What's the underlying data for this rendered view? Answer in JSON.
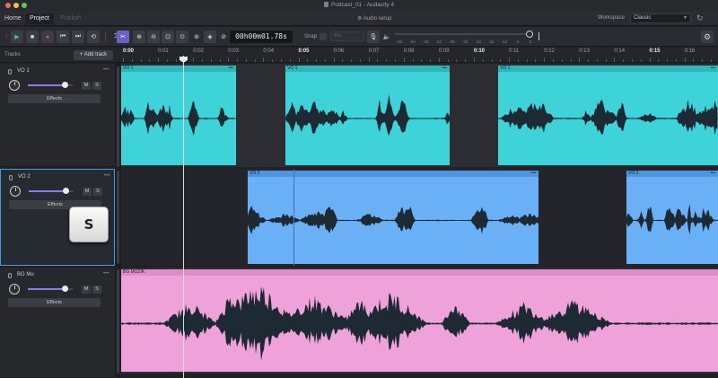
{
  "window": {
    "title": "Podcast_01 - Audacity 4"
  },
  "menubar": {
    "tabs": [
      {
        "label": "Home",
        "state": "normal"
      },
      {
        "label": "Project",
        "state": "active"
      },
      {
        "label": "Publish",
        "state": "disabled"
      }
    ],
    "center_items": [
      {
        "label": "Audio setup",
        "icon": "audio-setup-icon"
      }
    ],
    "workspace_label": "Workspace",
    "workspace_value": "Classic"
  },
  "toolbar": {
    "timecode": "00h00m01.78s",
    "snap_label": "Snap",
    "snap_select": "Bar",
    "meter_ticks": [
      "-60",
      "-54",
      "-48",
      "-42",
      "-36",
      "-30",
      "-24",
      "-18",
      "-12",
      "-6",
      "0"
    ]
  },
  "tracks_header": {
    "label": "Tracks",
    "add_track": "+ Add track"
  },
  "ruler": {
    "labels": [
      {
        "t": "0:00",
        "major": true
      },
      {
        "t": "0:01"
      },
      {
        "t": "0:02"
      },
      {
        "t": "0:03"
      },
      {
        "t": "0:04"
      },
      {
        "t": "0:05",
        "major": true
      },
      {
        "t": "0:06"
      },
      {
        "t": "0:07"
      },
      {
        "t": "0:08"
      },
      {
        "t": "0:09"
      },
      {
        "t": "0:10",
        "major": true
      },
      {
        "t": "0:11"
      },
      {
        "t": "0:12"
      },
      {
        "t": "0:13"
      },
      {
        "t": "0:14"
      },
      {
        "t": "0:15",
        "major": true
      },
      {
        "t": "0:16"
      }
    ]
  },
  "tracks": [
    {
      "name": "VO 1",
      "mute": "M",
      "solo": "S",
      "effects": "Effects",
      "volume": 0.82,
      "selected": false,
      "clips": [
        {
          "label": "VO 1",
          "color": "#3dd3d9",
          "header": "#2fb5bb"
        },
        {
          "label": "VO 1",
          "color": "#3dd3d9",
          "header": "#2fb5bb"
        },
        {
          "label": "VO 1",
          "color": "#3dd3d9",
          "header": "#2fb5bb"
        }
      ]
    },
    {
      "name": "VO 2",
      "mute": "M",
      "solo": "S",
      "effects": "Effects",
      "volume": 0.82,
      "selected": true,
      "clips": [
        {
          "label": "VO 2",
          "color": "#6ab0f7",
          "header": "#4d95de"
        },
        {
          "label": "VO 2",
          "color": "#6ab0f7",
          "header": "#4d95de"
        }
      ]
    },
    {
      "name": "BG Mu",
      "mute": "M",
      "solo": "S",
      "effects": "Effects",
      "volume": 0.82,
      "selected": false,
      "clips": [
        {
          "label": "BG MUZIK",
          "color": "#efa1d9",
          "header": "#e08ccb"
        }
      ]
    }
  ],
  "key_overlay": "S"
}
